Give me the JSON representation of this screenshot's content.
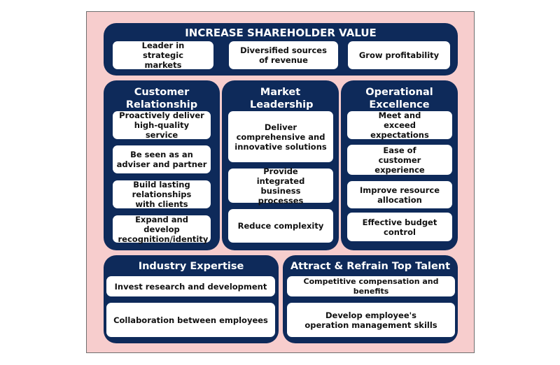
{
  "top": {
    "title": "INCREASE SHAREHOLDER VALUE",
    "cards": [
      "Leader in strategic markets",
      "Diversified sources of revenue",
      "Grow profitability"
    ]
  },
  "columns": [
    {
      "title": "Customer Relationship",
      "cards": [
        "Proactively deliver high-quality service",
        "Be seen as an adviser and partner",
        "Build lasting relationships with clients",
        "Expand and develop recognition/identity"
      ]
    },
    {
      "title": "Market Leadership",
      "cards": [
        "Deliver comprehensive and innovative solutions",
        "Provide integrated business processes",
        "Reduce complexity"
      ]
    },
    {
      "title": "Operational Excellence",
      "cards": [
        "Meet and exceed expectations",
        "Ease of customer experience",
        "Improve resource allocation",
        "Effective budget control"
      ]
    }
  ],
  "bottom": [
    {
      "title": "Industry Expertise",
      "cards": [
        "Invest research and development",
        "Collaboration between employees"
      ]
    },
    {
      "title": "Attract & Refrain Top Talent",
      "cards": [
        "Competitive compensation and benefits",
        "Develop employee's operation management skills"
      ]
    }
  ],
  "colors": {
    "panel": "#0e2a5a",
    "background": "#f7cdcd",
    "card": "#ffffff"
  }
}
